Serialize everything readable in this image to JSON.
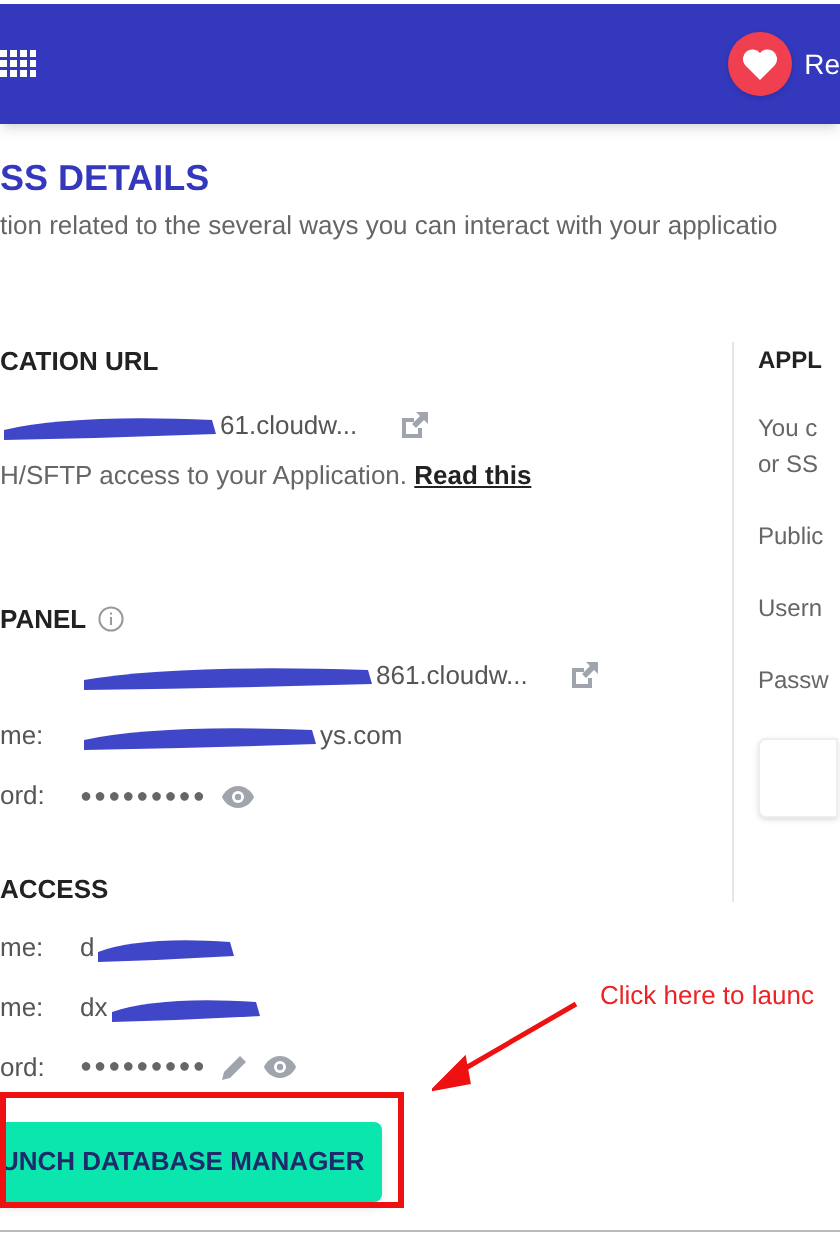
{
  "header": {
    "label": "Re"
  },
  "page": {
    "title": "SS DETAILS",
    "subtitle": "tion related to the several ways you can interact with your applicatio"
  },
  "app_url": {
    "heading": "CATION URL",
    "url": {
      "redacted": true,
      "value": "61.cloudw..."
    },
    "note": "H/SFTP access to your Application.",
    "note_link": "Read this"
  },
  "panel": {
    "heading": "PANEL",
    "rows": [
      {
        "kind": "link",
        "label": "",
        "redacted": true,
        "value": "861.cloudw..."
      },
      {
        "kind": "text",
        "label": "me:",
        "redacted": true,
        "value": "ys.com"
      },
      {
        "kind": "secret",
        "label": "ord:",
        "redacted": false,
        "value": "●●●●●●●●●"
      }
    ]
  },
  "db_access": {
    "heading": "ACCESS",
    "rows": [
      {
        "kind": "text",
        "label": "me:",
        "redacted": true,
        "value": "d"
      },
      {
        "kind": "text",
        "label": "me:",
        "redacted": true,
        "value": "dx"
      },
      {
        "kind": "secret_editable",
        "label": "ord:",
        "redacted": false,
        "value": "●●●●●●●●●"
      }
    ],
    "button": "UNCH DATABASE MANAGER"
  },
  "side": {
    "heading": "APPL",
    "lines": [
      "You c",
      "or SS"
    ],
    "fields": [
      "Public",
      "Usern",
      "Passw"
    ]
  },
  "annotation": {
    "text": "Click here to launc"
  }
}
